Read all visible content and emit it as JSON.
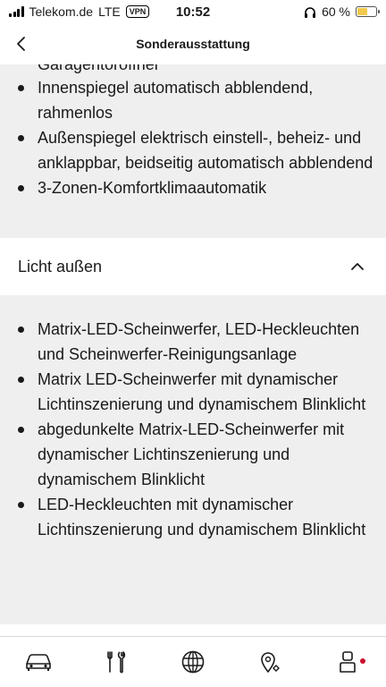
{
  "status_bar": {
    "carrier": "Telekom.de",
    "network": "LTE",
    "vpn": "VPN",
    "time": "10:52",
    "battery_percent": "60 %",
    "battery_level": 0.6
  },
  "header": {
    "title": "Sonderausstattung"
  },
  "section_above": {
    "partial_text": "Garagentoröffner",
    "items": [
      "Innenspiegel automatisch abblendend, rahmenlos",
      "Außenspiegel elektrisch einstell-, beheiz- und anklappbar, beidseitig automatisch abblendend",
      "3-Zonen-Komfortklimaautomatik"
    ]
  },
  "section_licht": {
    "title": "Licht außen",
    "expanded": true,
    "items": [
      "Matrix-LED-Scheinwerfer, LED-Heckleuchten und Scheinwerfer-Reinigungsanlage",
      "Matrix LED-Scheinwerfer mit dynamischer Lichtinszenierung und dynamischem Blinklicht",
      "abgedunkelte Matrix-LED-Scheinwerfer mit dynamischer Lichtinszenierung und dynamischem Blinklicht",
      "LED-Heckleuchten mit dynamischer Lichtinszenierung und dynamischem Blinklicht"
    ]
  },
  "tab_bar": {
    "tabs": [
      "car-icon",
      "tools-icon",
      "globe-icon",
      "map-pin-icon",
      "user-icon"
    ],
    "badge_color": "#c8102e"
  }
}
